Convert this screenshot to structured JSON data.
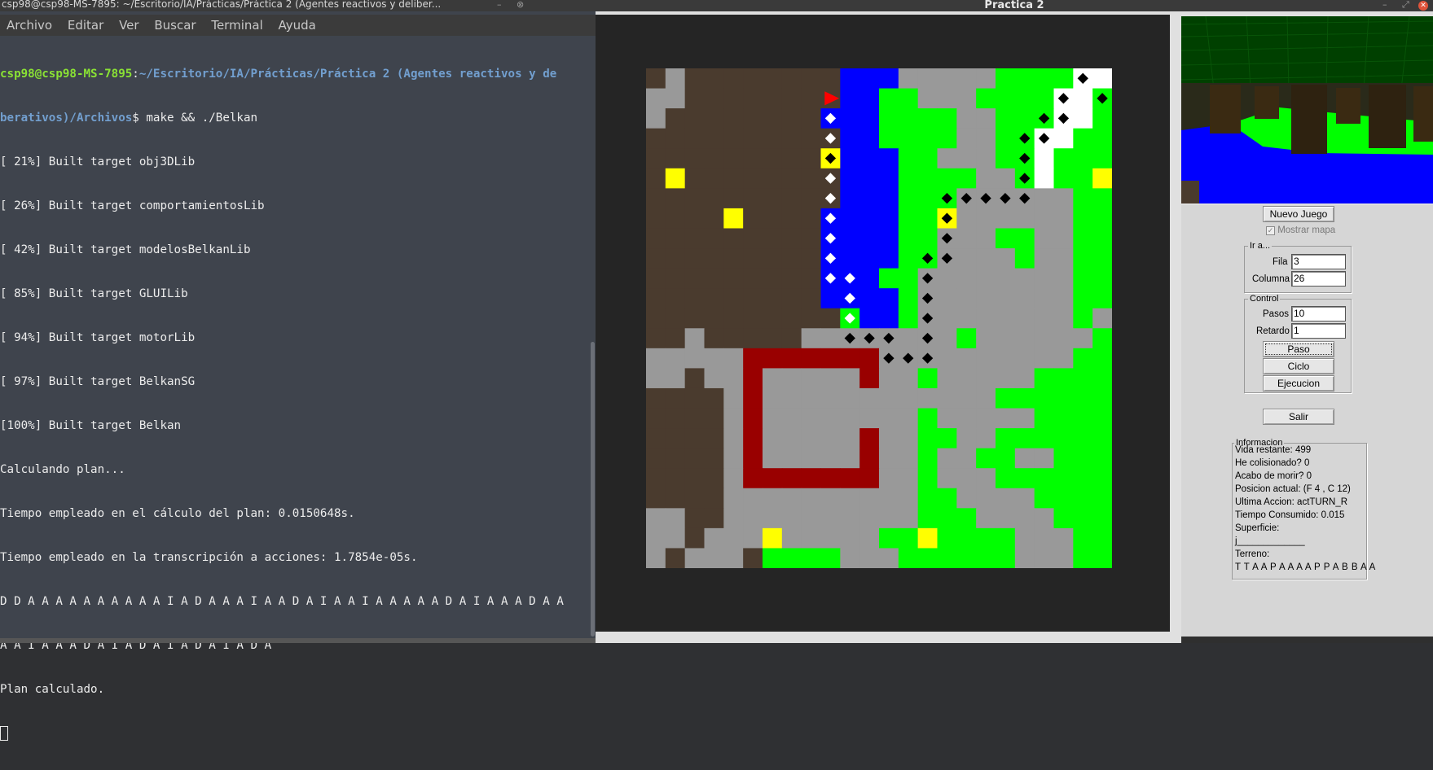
{
  "terminal": {
    "title": "csp98@csp98-MS-7895: ~/Escritorio/IA/Prácticas/Práctica 2 (Agentes reactivos y deliber...",
    "menu": [
      "Archivo",
      "Editar",
      "Ver",
      "Buscar",
      "Terminal",
      "Ayuda"
    ],
    "prompt_user": "csp98@csp98-MS-7895",
    "prompt_path_1": "~/Escritorio/IA/Prácticas/Práctica 2 (Agentes reactivos y de",
    "prompt_path_2": "berativos)/Archivos",
    "command": "$ make && ./Belkan",
    "lines": [
      "[ 21%] Built target obj3DLib",
      "[ 26%] Built target comportamientosLib",
      "[ 42%] Built target modelosBelkanLib",
      "[ 85%] Built target GLUILib",
      "[ 94%] Built target motorLib",
      "[ 97%] Built target BelkanSG",
      "[100%] Built target Belkan",
      "Calculando plan...",
      "Tiempo empleado en el cálculo del plan: 0.0150648s.",
      "Tiempo empleado en la transcripción a acciones: 1.7854e-05s.",
      "D D A A A A A A A A A A I A D A A A I A A D A I A A I A A A A A D A I A A A D A A",
      "A A I A A A D A I A D A I A D A I A D A",
      "Plan calculado."
    ]
  },
  "game": {
    "title": "Practica 2",
    "nuevo_juego": "Nuevo Juego",
    "mostrar_mapa": "Mostrar mapa",
    "ir_a": {
      "label": "Ir a...",
      "fila_label": "Fila",
      "fila_value": "3",
      "columna_label": "Columna",
      "columna_value": "26"
    },
    "control": {
      "label": "Control",
      "pasos_label": "Pasos",
      "pasos_value": "10",
      "retardo_label": "Retardo",
      "retardo_value": "1",
      "paso": "Paso",
      "ciclo": "Ciclo",
      "ejecucion": "Ejecucion"
    },
    "salir": "Salir",
    "informacion": {
      "label": "Informacion",
      "vida": "Vida restante: 499",
      "colision": "He colisionado? 0",
      "morir": "Acabo de morir? 0",
      "posicion": "Posicion actual: (F 4 , C 12)",
      "accion": "Ultima Accion: actTURN_R",
      "tiempo": "Tiempo Consumido: 0.015",
      "superficie": "Superficie:",
      "superficie_value": "j_____________",
      "terreno": "Terreno:",
      "terreno_value": "T T A A P A A A A P P A B B A A"
    }
  },
  "map": {
    "rows": [
      "TSTTTTTTTTAAASSSSSGGGGBB",
      "SSTTTTTTTTAAGGSSSGGGGBBG",
      "STTTTTTTTAAAGGGGSSGGGBBG",
      "TTTTTTTTTTAAGGGGSSGGBBGG",
      "TTTTTTTTTTAAAGGSSSGGBGGG",
      "TTTTTTTTTTAAAGGGGSSGBGGG",
      "TTTTTTTTTTAAAGGGSSSSSSGG",
      "TTTTTTTTTAAAAGGSSSSSSSGG",
      "TTTTTTTTTAAAAGGSSSGGSSGG",
      "TTTTTTTTTAAAAGGSSSSGSSGG",
      "TTTTTTTTTAAAGGSSSSSSSSGG",
      "TTTTTTTTTAAAAGSSSSSSSSGG",
      "TTTTTTTTTTGAAGSSSSSSSSGS",
      "TTSTTTTTSSSSSSSSGSSSSSSG",
      "SSSSSRRRRRRRSSSSSSSSSSGG",
      "SSTSSRSSSSSRSSGSSSSSGGGG",
      "TTTTSRSSSSSSSSSSSSGGGGGG",
      "TTTTSRSSSSSSSSGSSSSSGGGG",
      "TTTTSRSSSSSRSSGGSSGGGGGG",
      "TTTTSRSSSSSRSSGSSGGSSGGG",
      "TTTTSRRRRRRRSSGSSSGGGGGG",
      "TTTTSSSSSSSSSSGGSSSSGGGG",
      "SSTTSSSSSSSSSSGGGSSSSGGG",
      "SSTSSSSSSSSSGGSGGGGSSSGG",
      "STSSSTGGGGSSSGGGGGGSSSGG"
    ],
    "yellow_cells": [
      [
        5,
        1
      ],
      [
        7,
        4
      ],
      [
        4,
        9
      ],
      [
        7,
        15
      ],
      [
        5,
        23
      ],
      [
        23,
        6
      ],
      [
        23,
        14
      ]
    ],
    "white_path": [
      [
        2,
        9
      ],
      [
        3,
        9
      ],
      [
        5,
        9
      ],
      [
        6,
        9
      ],
      [
        7,
        9
      ],
      [
        8,
        9
      ],
      [
        9,
        9
      ],
      [
        10,
        9
      ],
      [
        10,
        10
      ],
      [
        11,
        10
      ],
      [
        12,
        10
      ]
    ],
    "black_path": [
      [
        0,
        22
      ],
      [
        1,
        21
      ],
      [
        1,
        23
      ],
      [
        2,
        20
      ],
      [
        2,
        21
      ],
      [
        3,
        19
      ],
      [
        3,
        20
      ],
      [
        4,
        19
      ],
      [
        5,
        19
      ],
      [
        6,
        15
      ],
      [
        6,
        16
      ],
      [
        6,
        17
      ],
      [
        6,
        18
      ],
      [
        6,
        19
      ],
      [
        7,
        15
      ],
      [
        8,
        15
      ],
      [
        9,
        14
      ],
      [
        9,
        15
      ],
      [
        10,
        14
      ],
      [
        11,
        14
      ],
      [
        12,
        14
      ],
      [
        13,
        10
      ],
      [
        13,
        11
      ],
      [
        13,
        12
      ],
      [
        13,
        14
      ],
      [
        14,
        12
      ],
      [
        14,
        13
      ],
      [
        14,
        14
      ],
      [
        4,
        9
      ]
    ],
    "goal_cell": [
      0,
      23
    ],
    "player_cell": [
      1,
      9
    ],
    "colors": {
      "T": "#4a3b2e",
      "S": "#999999",
      "A": "#0000ff",
      "G": "#00ff00",
      "B": "#ffffff",
      "R": "#990000",
      "Y": "#ffff00"
    }
  }
}
